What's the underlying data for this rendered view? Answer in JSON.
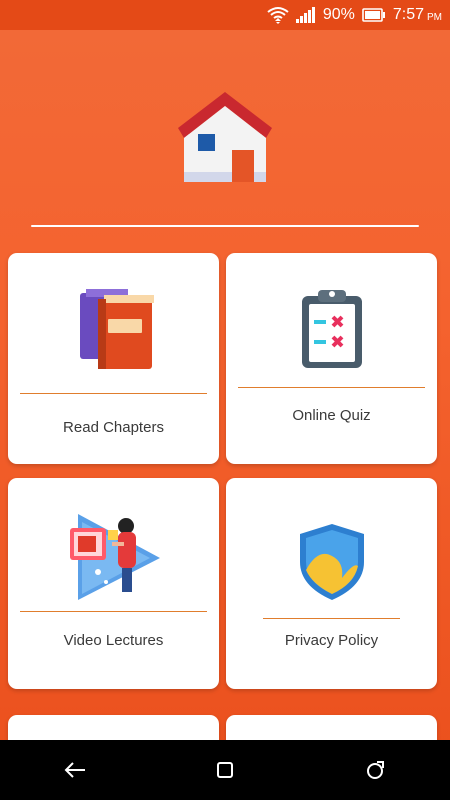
{
  "status_bar": {
    "battery_percent": "90%",
    "time": "7:57",
    "time_suffix": "PM",
    "icons": [
      "wifi-icon",
      "signal-icon",
      "battery-icon"
    ]
  },
  "header": {
    "logo_icon": "home-icon"
  },
  "menu": {
    "items": [
      {
        "label": "Read Chapters",
        "icon": "books-icon"
      },
      {
        "label": "Online Quiz",
        "icon": "clipboard-quiz-icon"
      },
      {
        "label": "Video Lectures",
        "icon": "video-lecture-icon"
      },
      {
        "label": "Privacy Policy",
        "icon": "shield-icon"
      }
    ]
  },
  "nav_bar": {
    "buttons": [
      "back-icon",
      "home-square-icon",
      "recents-icon"
    ]
  },
  "colors": {
    "background": "#f4622e",
    "status_bar": "#e44a17",
    "card": "#ffffff",
    "card_line": "#e07d2d",
    "label_text": "#3a3a3a"
  }
}
